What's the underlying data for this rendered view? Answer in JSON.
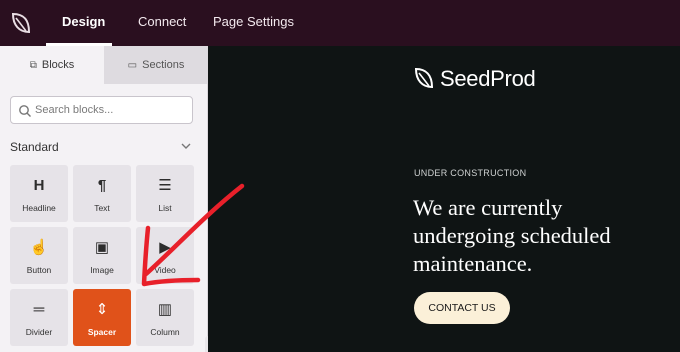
{
  "topbar": {
    "tabs": [
      {
        "label": "Design",
        "active": true
      },
      {
        "label": "Connect",
        "active": false
      },
      {
        "label": "Page Settings",
        "active": false
      }
    ],
    "bg_color": "#2a0f1f"
  },
  "sidebar": {
    "tabs": [
      {
        "label": "Blocks",
        "icon": "blocks-icon",
        "active": true
      },
      {
        "label": "Sections",
        "icon": "sections-icon",
        "active": false
      }
    ],
    "search": {
      "placeholder": "Search blocks..."
    },
    "section_title": "Standard",
    "blocks": [
      {
        "label": "Headline",
        "icon": "headline-icon",
        "glyph": "H"
      },
      {
        "label": "Text",
        "icon": "paragraph-icon",
        "glyph": "¶"
      },
      {
        "label": "List",
        "icon": "list-icon",
        "glyph": "☰"
      },
      {
        "label": "Button",
        "icon": "pointer-icon",
        "glyph": "☝"
      },
      {
        "label": "Image",
        "icon": "image-icon",
        "glyph": "▣"
      },
      {
        "label": "Video",
        "icon": "video-icon",
        "glyph": "▶"
      },
      {
        "label": "Divider",
        "icon": "divider-icon",
        "glyph": "═"
      },
      {
        "label": "Spacer",
        "icon": "spacer-icon",
        "glyph": "⇕",
        "active": true
      },
      {
        "label": "Column",
        "icon": "column-icon",
        "glyph": "▥"
      }
    ],
    "accent_color": "#e0521a"
  },
  "preview": {
    "brand": "SeedProd",
    "eyebrow": "UNDER CONSTRUCTION",
    "headline": "We are currently undergoing scheduled maintenance.",
    "cta_label": "CONTACT US",
    "cta_color": "#fbf0d8",
    "bg_color": "#0f1414"
  },
  "annotation": {
    "type": "red-arrow",
    "color": "#e8202a",
    "points_to": "Spacer"
  }
}
